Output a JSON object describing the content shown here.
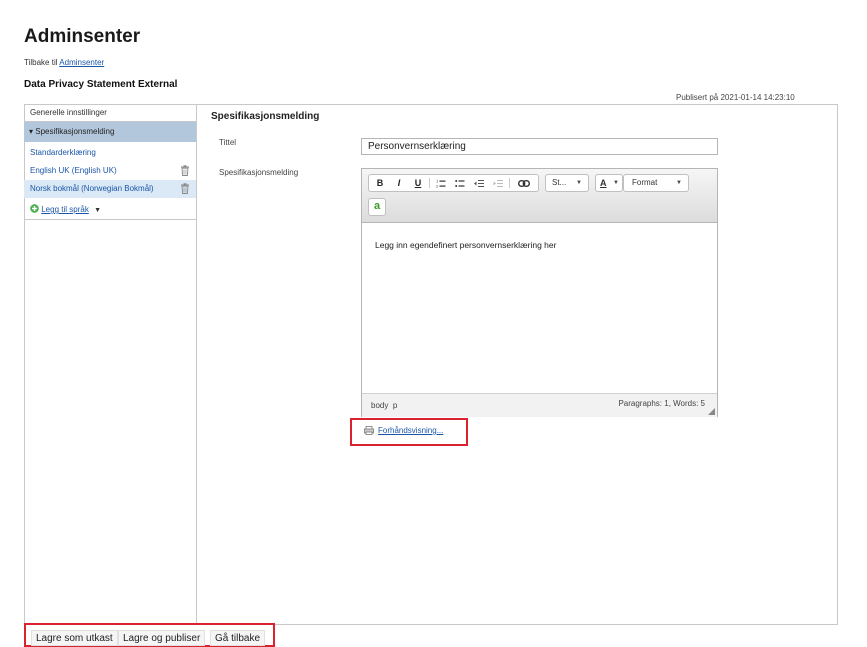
{
  "header": {
    "title": "Adminsenter",
    "back_prefix": "Tilbake til ",
    "back_link": "Adminsenter",
    "statement_title": "Data Privacy Statement External",
    "published": "Publisert på 2021-01-14 14:23:10"
  },
  "sidebar": {
    "general": "Generelle innstillinger",
    "section": "▾ Spesifikasjonsmelding",
    "items": [
      {
        "label": "Standarderklæring"
      },
      {
        "label": "English UK (English UK)"
      },
      {
        "label": "Norsk bokmål (Norwegian Bokmål)"
      }
    ],
    "add_language": "Legg til språk"
  },
  "panel": {
    "title": "Spesifikasjonsmelding",
    "title_label": "Tittel",
    "title_value": "Personvernserklæring",
    "message_label": "Spesifikasjonsmelding"
  },
  "editor": {
    "toolbar": {
      "bold": "B",
      "italic": "I",
      "underline": "U",
      "styles": "St...",
      "font_color": "A",
      "format": "Format",
      "spellcheck": "a"
    },
    "content": "Legg inn egendefinert personvernserklæring her",
    "path_body": "body",
    "path_p": "p",
    "word_count": "Paragraphs: 1, Words: 5"
  },
  "preview": {
    "label": "Forhåndsvisning..."
  },
  "actions": {
    "save_draft": "Lagre som utkast",
    "save_publish": "Lagre og publiser",
    "go_back": "Gå tilbake"
  },
  "colors": {
    "selected_section": "#b3c7dc",
    "selected_item": "#dbe9f6",
    "link": "#1a56a8",
    "highlight": "#d9232e",
    "spell_green": "#3a9a2a"
  },
  "icons": [
    "trash-icon",
    "add-circle-icon",
    "chevron-down-icon",
    "preview-icon",
    "link-icon",
    "numbered-list-icon",
    "bullet-list-icon",
    "outdent-icon",
    "indent-icon"
  ]
}
